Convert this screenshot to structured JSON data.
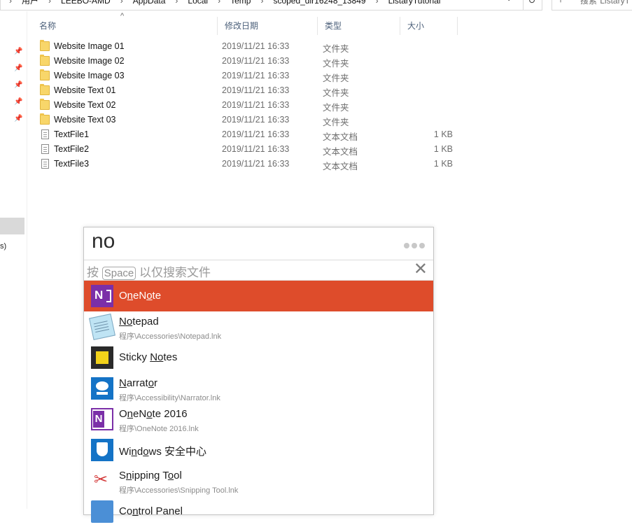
{
  "explorer": {
    "address": {
      "crumbs": [
        "用户",
        "LEEBO-AMD",
        "AppData",
        "Local",
        "Temp",
        "scoped_dir16248_13849",
        "ListaryTutorial"
      ],
      "separator": "›"
    },
    "search_placeholder": "搜索\"ListaryT",
    "columns": {
      "name": "名称",
      "date": "修改日期",
      "type": "类型",
      "size": "大小"
    },
    "files": [
      {
        "kind": "folder",
        "name": "Website Image 01",
        "date": "2019/11/21 16:33",
        "type": "文件夹",
        "size": ""
      },
      {
        "kind": "folder",
        "name": "Website Image 02",
        "date": "2019/11/21 16:33",
        "type": "文件夹",
        "size": ""
      },
      {
        "kind": "folder",
        "name": "Website Image 03",
        "date": "2019/11/21 16:33",
        "type": "文件夹",
        "size": ""
      },
      {
        "kind": "folder",
        "name": "Website Text 01",
        "date": "2019/11/21 16:33",
        "type": "文件夹",
        "size": ""
      },
      {
        "kind": "folder",
        "name": "Website Text 02",
        "date": "2019/11/21 16:33",
        "type": "文件夹",
        "size": ""
      },
      {
        "kind": "folder",
        "name": "Website Text 03",
        "date": "2019/11/21 16:33",
        "type": "文件夹",
        "size": ""
      },
      {
        "kind": "file",
        "name": "TextFile1",
        "date": "2019/11/21 16:33",
        "type": "文本文档",
        "size": "1 KB"
      },
      {
        "kind": "file",
        "name": "TextFile2",
        "date": "2019/11/21 16:33",
        "type": "文本文档",
        "size": "1 KB"
      },
      {
        "kind": "file",
        "name": "TextFile3",
        "date": "2019/11/21 16:33",
        "type": "文本文档",
        "size": "1 KB"
      }
    ],
    "nav_fragment": "s)"
  },
  "launcher": {
    "query": "no",
    "hint": {
      "prefix": "按",
      "key": "Space",
      "suffix": "以仅搜索文件"
    },
    "results": [
      {
        "icon": "onenote-icon",
        "title_parts": [
          [
            "O",
            false
          ],
          [
            "n",
            true
          ],
          [
            "eN",
            false
          ],
          [
            "o",
            true
          ],
          [
            "te",
            false
          ]
        ],
        "path": "",
        "selected": true
      },
      {
        "icon": "notepad-icon",
        "title_parts": [
          [
            "No",
            true
          ],
          [
            "tepad",
            false
          ]
        ],
        "path": "程序\\Accessories\\Notepad.lnk",
        "selected": false
      },
      {
        "icon": "sticky-notes-icon",
        "title_parts": [
          [
            "Sticky ",
            false
          ],
          [
            "No",
            true
          ],
          [
            "tes",
            false
          ]
        ],
        "path": "",
        "selected": false
      },
      {
        "icon": "narrator-icon",
        "title_parts": [
          [
            "N",
            true
          ],
          [
            "arrat",
            false
          ],
          [
            "o",
            true
          ],
          [
            "r",
            false
          ]
        ],
        "path": "程序\\Accessibility\\Narrator.lnk",
        "selected": false
      },
      {
        "icon": "onenote-2016-icon",
        "title_parts": [
          [
            "O",
            false
          ],
          [
            "n",
            true
          ],
          [
            "eN",
            false
          ],
          [
            "o",
            true
          ],
          [
            "te 2016",
            false
          ]
        ],
        "path": "程序\\OneNote 2016.lnk",
        "selected": false
      },
      {
        "icon": "windows-defender-icon",
        "title_parts": [
          [
            "Wi",
            false
          ],
          [
            "n",
            true
          ],
          [
            "d",
            false
          ],
          [
            "o",
            true
          ],
          [
            "ws 安全中心",
            false
          ]
        ],
        "path": "",
        "selected": false
      },
      {
        "icon": "snipping-tool-icon",
        "title_parts": [
          [
            "S",
            false
          ],
          [
            "n",
            true
          ],
          [
            "ipping T",
            false
          ],
          [
            "o",
            true
          ],
          [
            "ol",
            false
          ]
        ],
        "path": "程序\\Accessories\\Snipping Tool.lnk",
        "selected": false
      },
      {
        "icon": "control-panel-icon",
        "title_parts": [
          [
            "Co",
            false
          ],
          [
            "n",
            true
          ],
          [
            "trol Panel",
            false
          ]
        ],
        "path": "",
        "selected": false
      }
    ]
  }
}
